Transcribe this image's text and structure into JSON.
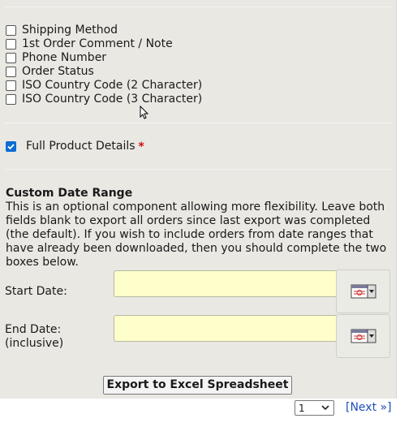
{
  "fields": [
    {
      "label": "Shipping Method",
      "checked": false
    },
    {
      "label": "1st Order Comment / Note",
      "checked": false
    },
    {
      "label": "Phone Number",
      "checked": false
    },
    {
      "label": "Order Status",
      "checked": false
    },
    {
      "label": "ISO Country Code (2 Character)",
      "checked": false
    },
    {
      "label": "ISO Country Code (3 Character)",
      "checked": false
    }
  ],
  "full_product": {
    "label": "Full Product Details",
    "checked": true,
    "required_mark": "*"
  },
  "date_range": {
    "title": "Custom Date Range",
    "description": "This is an optional component allowing more flexibility. Leave both fields blank to export all orders since last export was completed (the default). If you wish to include orders from date ranges that have already been downloaded, then you should complete the two boxes below.",
    "start_label": "Start Date:",
    "end_label_line1": "End Date:",
    "end_label_line2": "(inclusive)",
    "start_value": "",
    "end_value": ""
  },
  "export_button": "Export to Excel Spreadsheet",
  "pagination": {
    "selected_page": "1",
    "next_label": "[Next »]"
  },
  "colors": {
    "panel": "#e9e8e3",
    "input_bg": "#ffffcc",
    "link": "#1d4fb8",
    "required": "#d10f0f",
    "checkbox_checked": "#0a6cd4"
  }
}
